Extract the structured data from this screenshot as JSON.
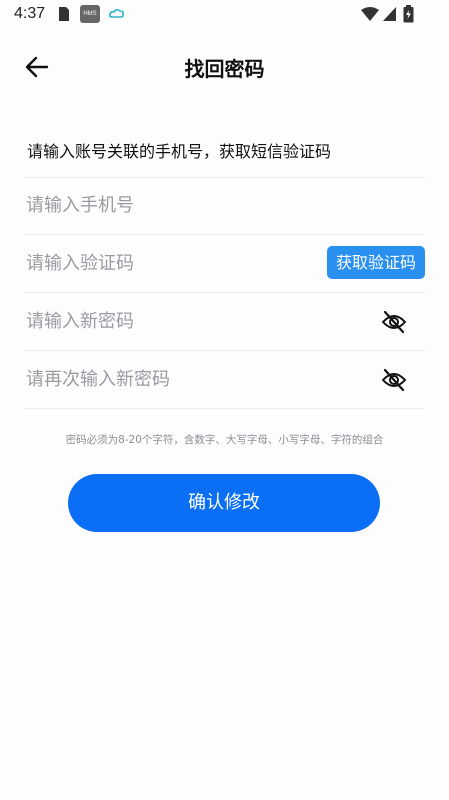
{
  "status_bar": {
    "time": "4:37",
    "notification_badge": "HMS"
  },
  "header": {
    "title": "找回密码"
  },
  "form": {
    "instruction": "请输入账号关联的手机号，获取短信验证码",
    "phone_placeholder": "请输入手机号",
    "code_placeholder": "请输入验证码",
    "get_code_label": "获取验证码",
    "new_password_placeholder": "请输入新密码",
    "confirm_password_placeholder": "请再次输入新密码",
    "password_hint": "密码必须为8-20个字符，含数字、大写字母、小写字母、字符的组合",
    "submit_label": "确认修改"
  },
  "colors": {
    "primary": "#0a6ff5",
    "code_button": "#2a90f0"
  }
}
